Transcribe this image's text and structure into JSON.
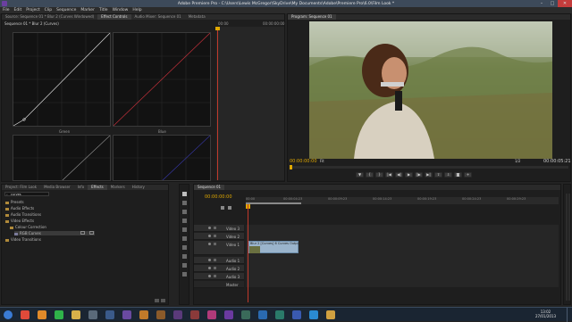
{
  "window": {
    "title": "Adobe Premiere Pro - C:\\Users\\Lewis McGregor\\SkyDrive\\My Documents\\Adobe\\Premiere Pro\\6.0\\Film Look *",
    "controls": [
      "–",
      "□",
      "✕"
    ]
  },
  "menu": [
    "File",
    "Edit",
    "Project",
    "Clip",
    "Sequence",
    "Marker",
    "Title",
    "Window",
    "Help"
  ],
  "effect_controls": {
    "tabs": [
      "Source: Sequence 01 * Blur 2 (Curves Windowed)",
      "Effect Controls",
      "Audio Mixer: Sequence 01",
      "Metadata"
    ],
    "header": "Sequence 01 * Blur 2 (Curves)",
    "tc_start": "00:00",
    "tc_end": "00:00:00:00",
    "graph_labels": [
      "Green",
      "Blue"
    ]
  },
  "program_monitor": {
    "tab": "Program: Sequence 01",
    "tc_current": "00:00:00:00",
    "fit": "Fit",
    "quality": "1/2",
    "tc_duration": "00:00:05:21"
  },
  "effects_panel": {
    "tabs": [
      "Project: Film Look",
      "Media Browser",
      "Info",
      "Effects",
      "Markers",
      "History"
    ],
    "search": "curves",
    "items": [
      {
        "label": "Presets",
        "level": 0
      },
      {
        "label": "Audio Effects",
        "level": 0
      },
      {
        "label": "Audio Transitions",
        "level": 0
      },
      {
        "label": "Video Effects",
        "level": 0
      },
      {
        "label": "Colour Correction",
        "level": 1
      },
      {
        "label": "RGB Curves",
        "level": 2
      },
      {
        "label": "Video Transitions",
        "level": 0
      }
    ]
  },
  "timeline": {
    "tab": "Sequence 01",
    "timecode": "00:00:00:00",
    "ruler": [
      "00:00",
      "00:00:04:23",
      "00:00:09:23",
      "00:00:14:23",
      "00:00:19:23",
      "00:00:24:23",
      "00:00:29:23",
      "00:00:34:23"
    ],
    "video_tracks": [
      "Video 3",
      "Video 2",
      "Video 1"
    ],
    "audio_tracks": [
      "Audio 1",
      "Audio 2",
      "Audio 3",
      "Master"
    ],
    "clip_label": "Blur 2 [Curves] 6 Curves Output ·"
  },
  "taskbar": {
    "time": "13:02",
    "date": "27/01/2013",
    "icons": [
      {
        "name": "start-orb-icon",
        "color": "#3a7bd5"
      },
      {
        "name": "chrome-icon",
        "color": "#e04a3a"
      },
      {
        "name": "firefox-icon",
        "color": "#e08a2a"
      },
      {
        "name": "spotify-icon",
        "color": "#2fb34a"
      },
      {
        "name": "explorer-icon",
        "color": "#d8b04a"
      },
      {
        "name": "calculator-icon",
        "color": "#5a6a7a"
      },
      {
        "name": "media-icon",
        "color": "#3a5a8a"
      },
      {
        "name": "after-effects-icon",
        "color": "#6a4aa0"
      },
      {
        "name": "illustrator-icon",
        "color": "#c07a2a"
      },
      {
        "name": "bridge-icon",
        "color": "#8a5a2a"
      },
      {
        "name": "encore-icon",
        "color": "#5a3a7a"
      },
      {
        "name": "fireworks-icon",
        "color": "#8a3a3a"
      },
      {
        "name": "indesign-icon",
        "color": "#b03a7a"
      },
      {
        "name": "premiere-icon",
        "color": "#6a3aa0"
      },
      {
        "name": "speedgrade-icon",
        "color": "#3a6a5a"
      },
      {
        "name": "photoshop-icon",
        "color": "#2a6ab0"
      },
      {
        "name": "audition-icon",
        "color": "#2a7a6a"
      },
      {
        "name": "ms-word-icon",
        "color": "#3a5ab0"
      },
      {
        "name": "skype-icon",
        "color": "#2a8ad0"
      },
      {
        "name": "folder-icon",
        "color": "#d0a040"
      }
    ]
  },
  "colors": {
    "accent_timecode": "#e0a800",
    "playhead": "#c0392b",
    "clip_fill": "#9ab4cc"
  }
}
